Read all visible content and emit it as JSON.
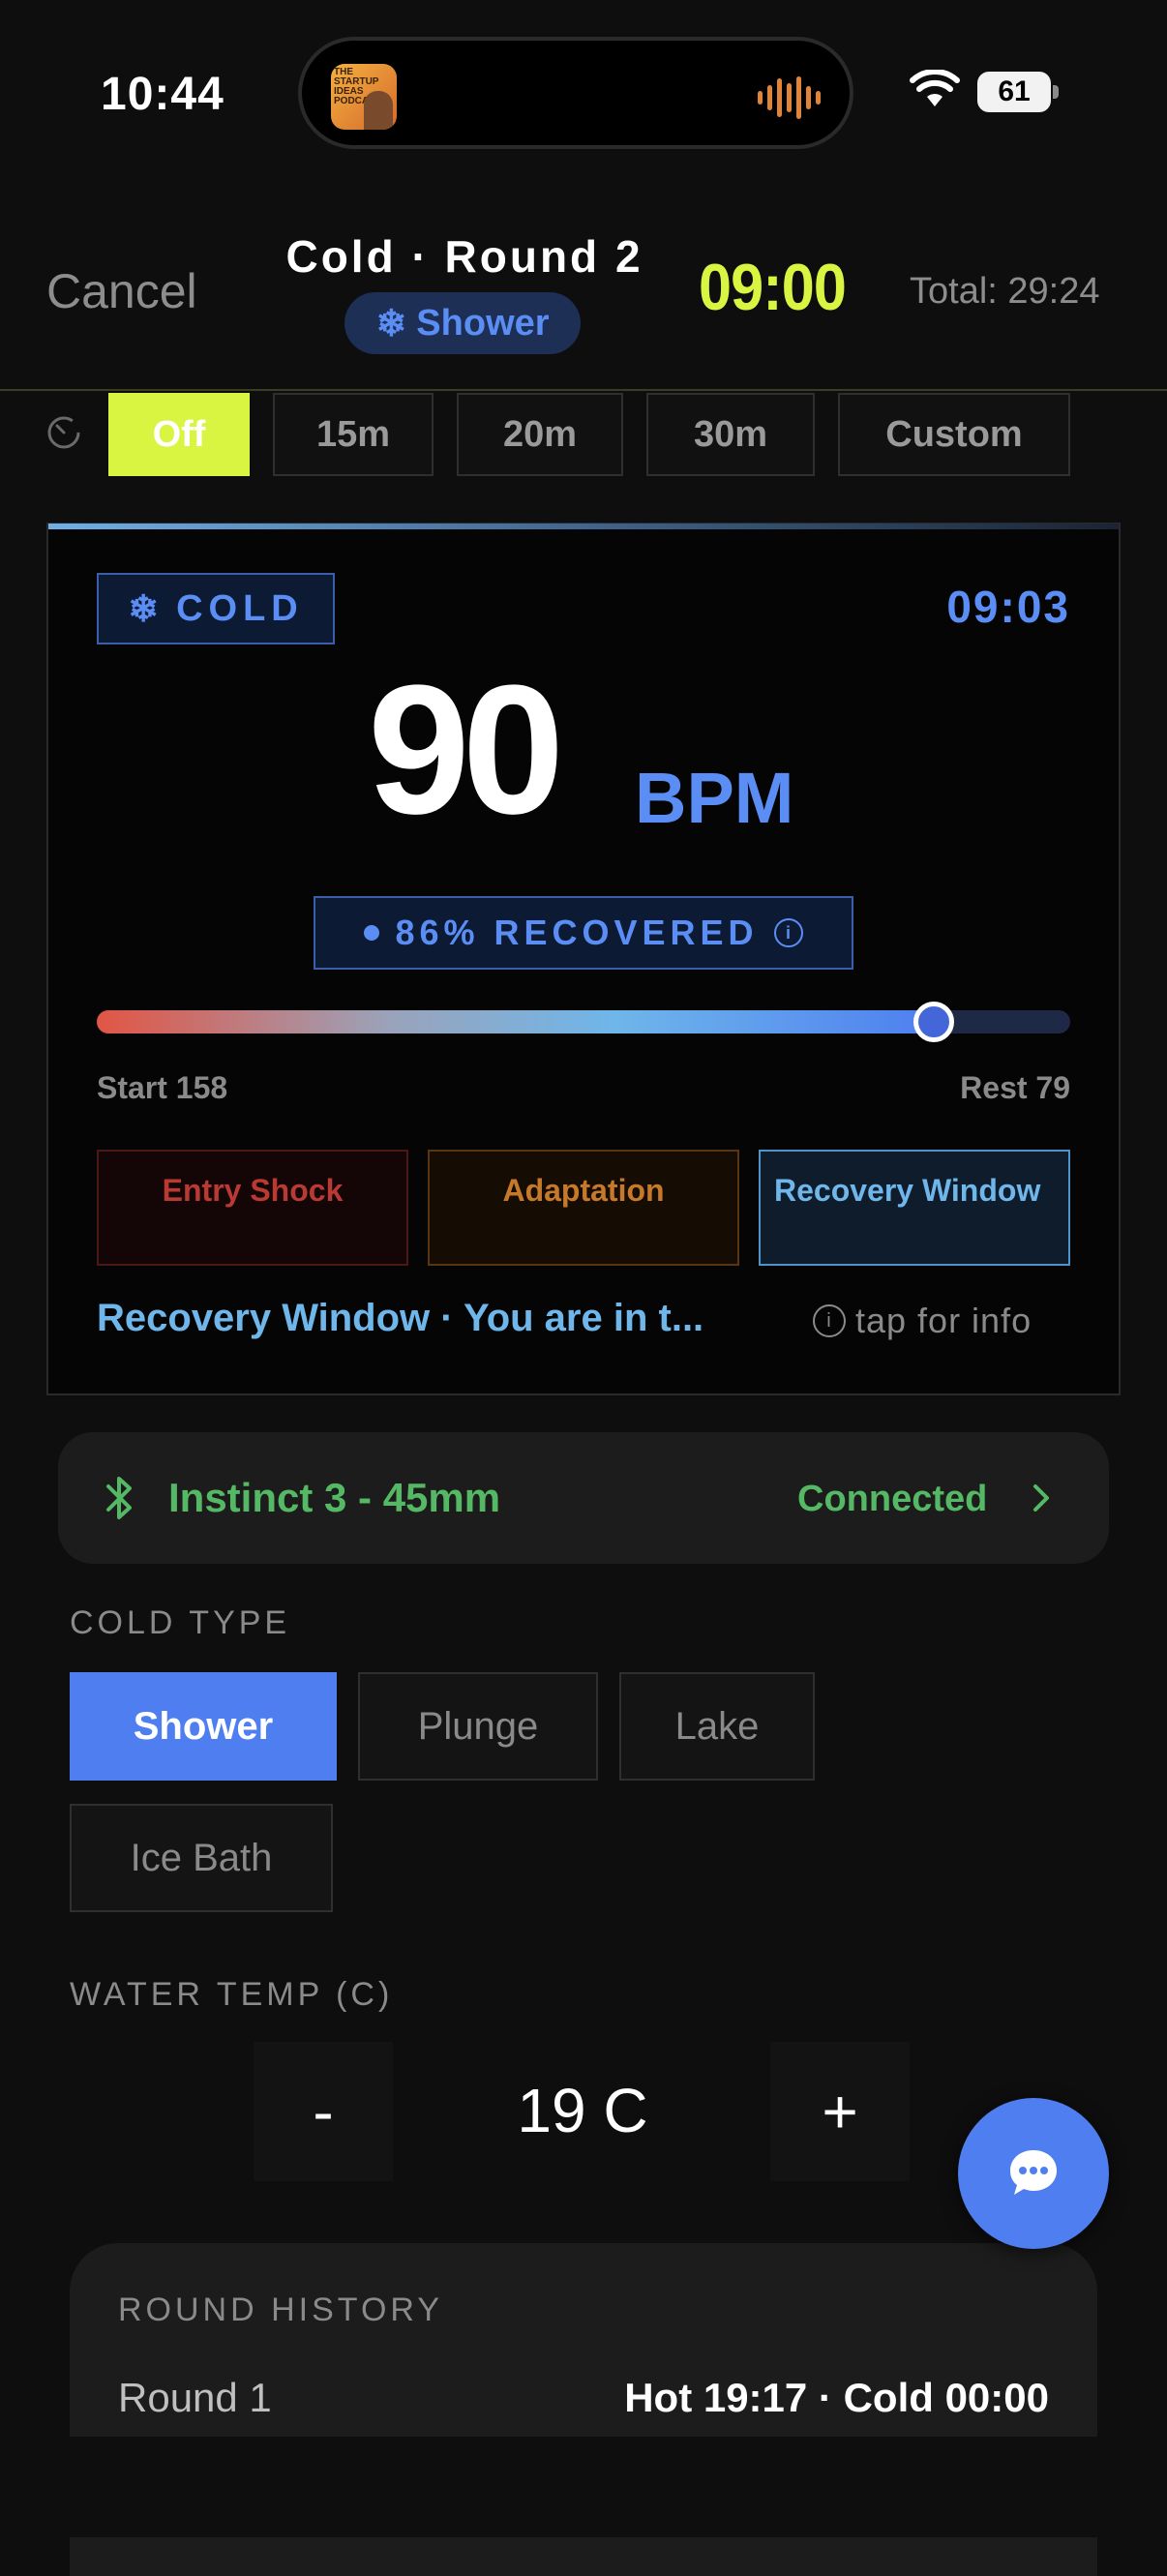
{
  "status_bar": {
    "time": "10:44",
    "battery": "61",
    "now_playing_art_text": "THE STARTUP IDEAS PODCAST"
  },
  "header": {
    "cancel_label": "Cancel",
    "title": "Cold · Round 2",
    "type_pill": "Shower",
    "countdown": "09:00",
    "total": "Total: 29:24"
  },
  "timer_options": {
    "options": [
      "Off",
      "15m",
      "20m",
      "30m",
      "Custom"
    ],
    "selected": "Off"
  },
  "recovery_card": {
    "badge": "COLD",
    "elapsed": "09:03",
    "bpm": "90",
    "bpm_unit": "BPM",
    "recovered_text": "86% RECOVERED",
    "recovered_percent": 86,
    "slider_fraction": 0.86,
    "start_label": "Start 158",
    "rest_label": "Rest 79",
    "phases": [
      "Entry Shock",
      "Adaptation",
      "Recovery Window"
    ],
    "active_phase": "Recovery Window",
    "phase_description": "Recovery Window · You are in t...",
    "tap_info": "tap for info"
  },
  "device": {
    "name": "Instinct 3 - 45mm",
    "status": "Connected"
  },
  "cold_type": {
    "label": "COLD TYPE",
    "options": [
      "Shower",
      "Plunge",
      "Lake",
      "Ice Bath"
    ],
    "selected": "Shower"
  },
  "water_temp": {
    "label": "WATER TEMP (C)",
    "decrement": "-",
    "value": "19 C",
    "increment": "+"
  },
  "round_history": {
    "label": "ROUND HISTORY",
    "rows": [
      {
        "round": "Round 1",
        "times": "Hot 19:17 · Cold 00:00"
      }
    ]
  },
  "colors": {
    "accent_lime": "#d9f542",
    "accent_blue": "#4f7ef0",
    "connected_green": "#55b865"
  },
  "icons": [
    "wifi-icon",
    "battery-icon",
    "snowflake-icon",
    "timer-icon",
    "info-icon",
    "bluetooth-icon",
    "chevron-right-icon",
    "chat-icon"
  ]
}
